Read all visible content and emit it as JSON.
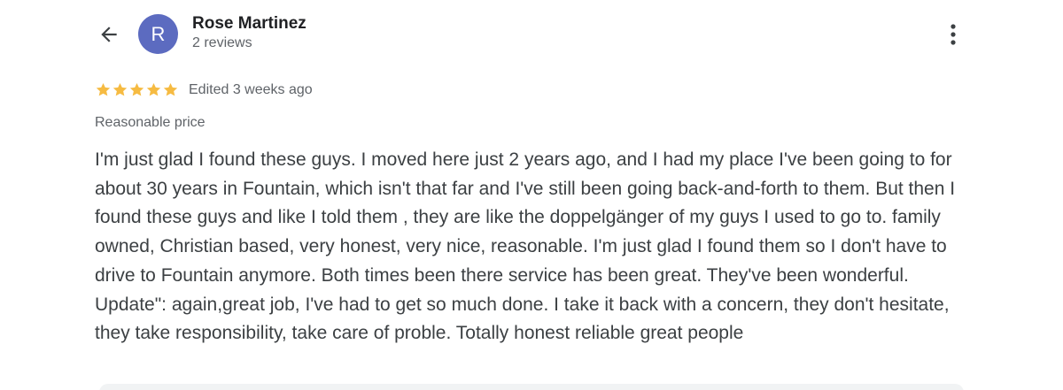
{
  "header": {
    "back_icon": "arrow-left-icon",
    "avatar_initial": "R",
    "avatar_color": "#5c6bc0",
    "reviewer_name": "Rose Martinez",
    "review_count": "2 reviews",
    "more_icon": "more-vert-icon"
  },
  "review": {
    "rating": 5,
    "rating_max": 5,
    "star_color": "#f6bb42",
    "edited": "Edited 3 weeks ago",
    "tag": "Reasonable price",
    "text": "I'm just glad I found these guys. I moved here just 2 years ago, and I had my place I've been going to for about 30 years in Fountain, which isn't that far and I've still been going back-and-forth to them. But then I found these guys and like I told them , they are like the doppelgänger of my guys I used to go to. family owned, Christian based, very honest, very nice, reasonable. I'm just glad I found them so I don't have to drive to Fountain anymore. Both times been there service has been great. They've been wonderful. Update\": again,great job, I've had to get so much done. I take it back with a concern, they don't hesitate, they take responsibility, take care of proble. Totally honest reliable great people"
  }
}
